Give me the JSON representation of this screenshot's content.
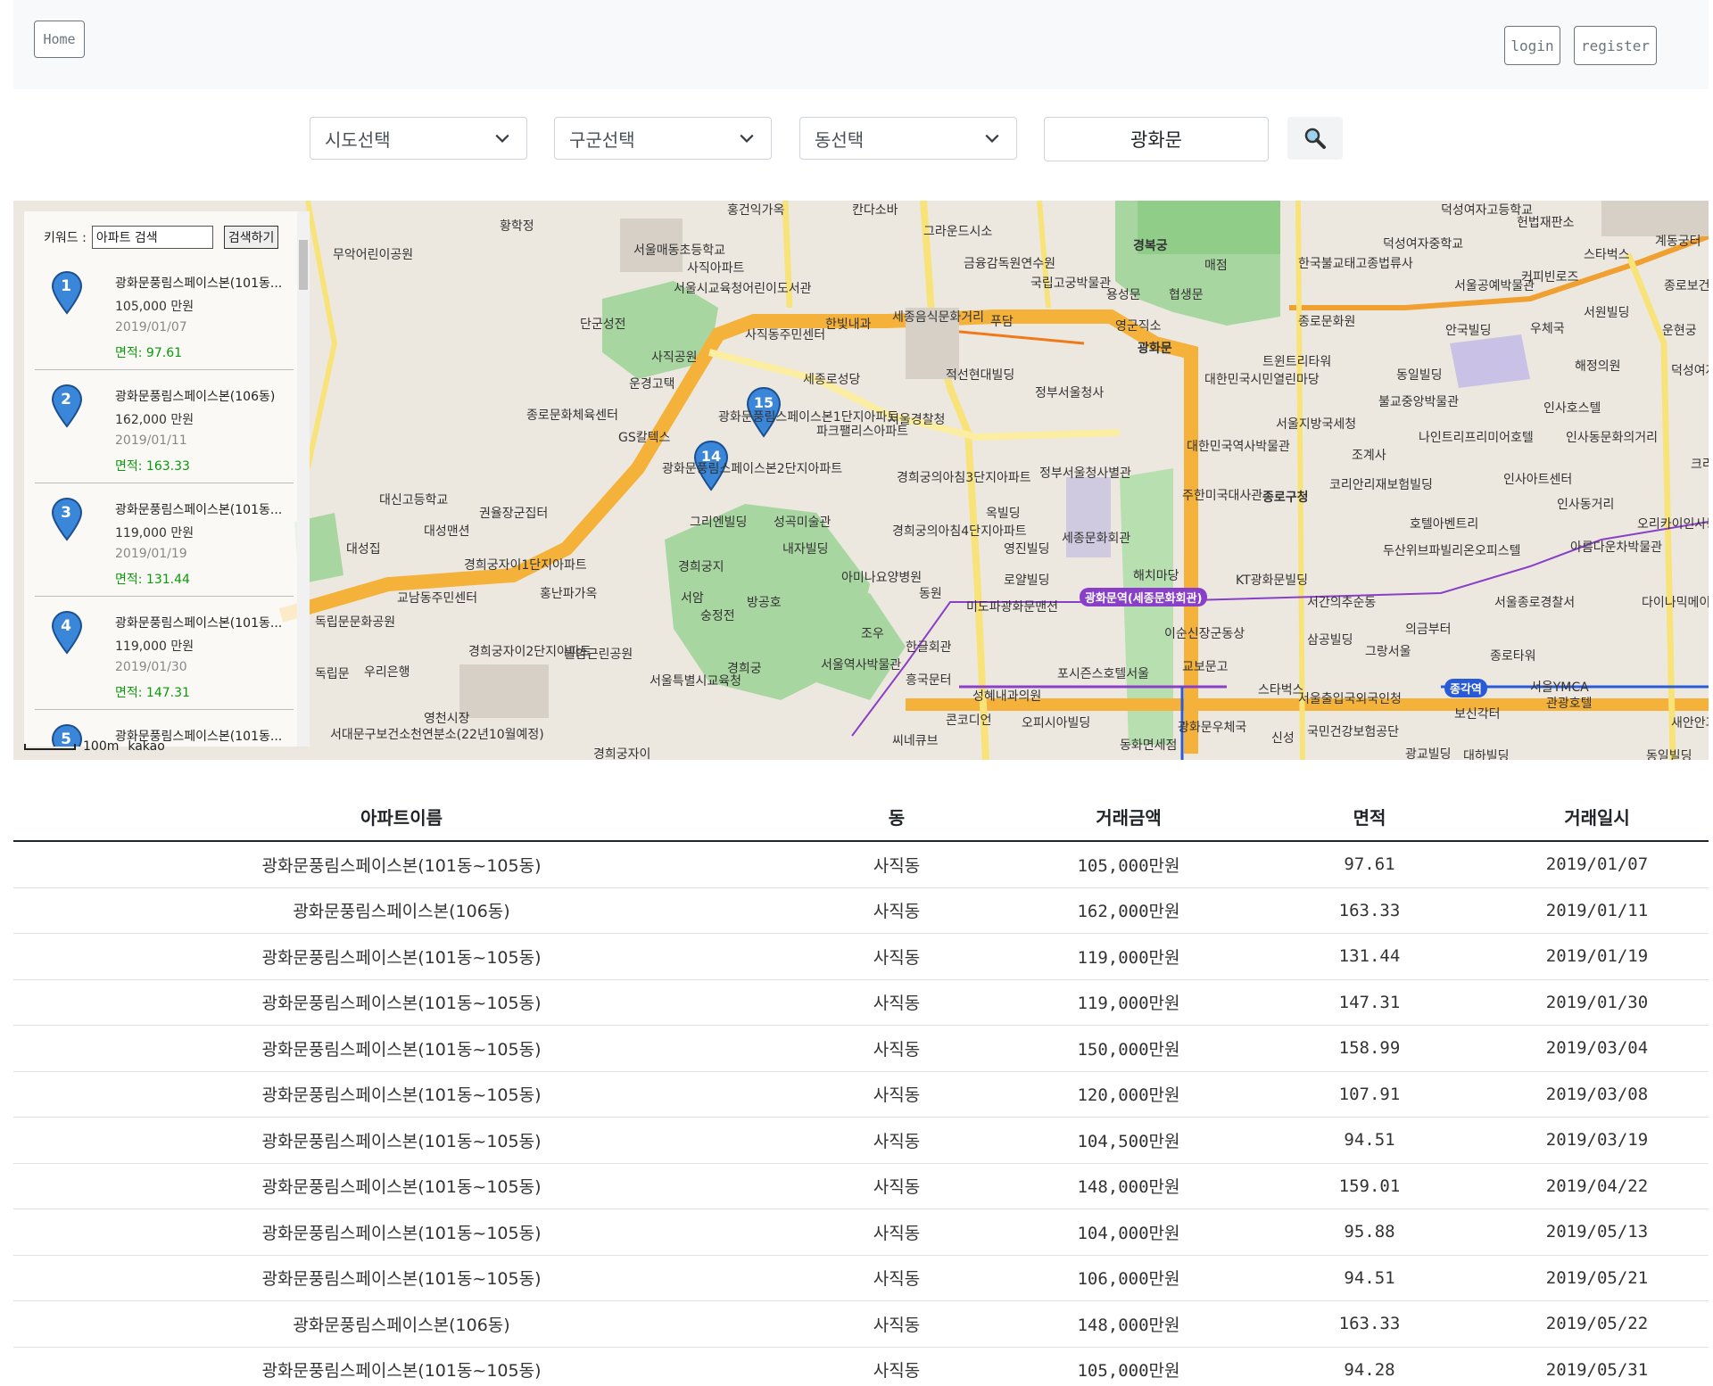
{
  "header": {
    "home_label": "Home",
    "login_label": "login",
    "register_label": "register"
  },
  "search": {
    "sido_label": "시도선택",
    "gugun_label": "구군선택",
    "dong_label": "동선택",
    "keyword_value": "광화문",
    "search_icon": "search-icon"
  },
  "map": {
    "panel": {
      "keyword_label": "키워드 :",
      "keyword_value": "아파트 검색",
      "search_button": "검색하기",
      "results": [
        {
          "num": "1",
          "name": "광화문풍림스페이스본(101동...",
          "price": "105,000 만원",
          "date": "2019/01/07",
          "area": "면적: 97.61"
        },
        {
          "num": "2",
          "name": "광화문풍림스페이스본(106동)",
          "price": "162,000 만원",
          "date": "2019/01/11",
          "area": "면적: 163.33"
        },
        {
          "num": "3",
          "name": "광화문풍림스페이스본(101동...",
          "price": "119,000 만원",
          "date": "2019/01/19",
          "area": "면적: 131.44"
        },
        {
          "num": "4",
          "name": "광화문풍림스페이스본(101동...",
          "price": "119,000 만원",
          "date": "2019/01/30",
          "area": "면적: 147.31"
        },
        {
          "num": "5",
          "name": "광화문풍림스페이스본(101동...",
          "price": "",
          "date": "",
          "area": ""
        }
      ]
    },
    "scale_label": "100m",
    "brand": "kakao",
    "markers": [
      "15",
      "14"
    ],
    "labels": [
      "홍건익가옥",
      "칸다소바",
      "그라운드시소",
      "황학정",
      "서울매동초등학교",
      "무악어린이공원",
      "사직아파트",
      "서울시교육청어린이도서관",
      "금융감독원연수원",
      "국립고궁박물관",
      "용성문",
      "협생문",
      "경복궁",
      "매점",
      "덕성여자중학교",
      "한국불교태고종법류사",
      "덕성여자고등학교",
      "헌법재판소",
      "서울공예박물관",
      "커피빈로즈",
      "스타벅스",
      "계동궁터",
      "종로보건소",
      "단군성전",
      "사직동주민센터",
      "한빛내과",
      "세종음식문화거리",
      "푸담",
      "영군직소",
      "종로문화원",
      "안국빌딩",
      "우체국",
      "서원빌딩",
      "운현궁",
      "사직공원",
      "세종로성당",
      "적선현대빌딩",
      "광화문",
      "트윈트리타워",
      "동일빌딩",
      "해정의원",
      "덕성여자대학교",
      "운경고택",
      "정부서울청사",
      "대한민국시민열린마당",
      "불교중앙박물관",
      "인사호스텔",
      "종로문화체육센터",
      "GS칼텍스",
      "광화문풍림스페이스본1단지아파트",
      "파크팰리스아파트",
      "서울경찰청",
      "서울지방국세청",
      "나인트리프리미어호텔",
      "조계사",
      "인사동문화의거리",
      "광화문풍림스페이스본2단지아파트",
      "경희궁의아침3단지아파트",
      "정부서울청사별관",
      "대한민국역사박물관",
      "코리안리재보험빌딩",
      "인사아트센터",
      "크리",
      "대신고등학교",
      "권율장군집터",
      "그리엔빌딩",
      "성곡미술관",
      "옥빌딩",
      "주한미국대사관",
      "종로구청",
      "인사동거리",
      "대성맨션",
      "호텔아벤트리",
      "오리카이인사동스위트",
      "대성집",
      "내자빌딩",
      "경희궁의아침4단지아파트",
      "영진빌딩",
      "세종문화회관",
      "두산위브파빌리온오피스텔",
      "아름다운차박물관",
      "경희궁자이1단지아파트",
      "경희궁지",
      "아미나요양병원",
      "로얄빌딩",
      "해치마당",
      "KT광화문빌딩",
      "교남동주민센터",
      "홍난파가옥",
      "서암",
      "숭정전",
      "방공호",
      "동원",
      "미도파광화문맨션",
      "광화문역(세종문화회관)",
      "서간의추순동",
      "서울종로경찰서",
      "다이나믹메이즈",
      "독립문문화공원",
      "우리은행",
      "경희궁자이2단지아파트",
      "월암근린공원",
      "조우",
      "한글회관",
      "이순신장군동상",
      "교보문고",
      "삼공빌딩",
      "그랑서울",
      "의금부터",
      "서울특별시교육청",
      "경희궁",
      "서울역사박물관",
      "흥국문터",
      "포시즌스호텔서울",
      "스타벅스",
      "종로타워",
      "서울YMCA",
      "종각역",
      "관광호텔",
      "독립문",
      "영천시장",
      "성혜내과의원",
      "콘코디언",
      "오피시아빌딩",
      "서울출입국외국인청",
      "보신각터",
      "새안안과의원",
      "서대문구보건소천연분소(22년10월예정)",
      "씨네큐브",
      "동화면세점",
      "광화문우체국",
      "신성",
      "국민건강보험공단",
      "광교빌딩",
      "경희궁자이",
      "대하빌딩",
      "동일빌딩"
    ]
  },
  "table": {
    "headers": [
      "아파트이름",
      "동",
      "거래금액",
      "면적",
      "거래일시"
    ],
    "rows": [
      [
        "광화문풍림스페이스본(101동~105동)",
        "사직동",
        "105,000만원",
        "97.61",
        "2019/01/07"
      ],
      [
        "광화문풍림스페이스본(106동)",
        "사직동",
        "162,000만원",
        "163.33",
        "2019/01/11"
      ],
      [
        "광화문풍림스페이스본(101동~105동)",
        "사직동",
        "119,000만원",
        "131.44",
        "2019/01/19"
      ],
      [
        "광화문풍림스페이스본(101동~105동)",
        "사직동",
        "119,000만원",
        "147.31",
        "2019/01/30"
      ],
      [
        "광화문풍림스페이스본(101동~105동)",
        "사직동",
        "150,000만원",
        "158.99",
        "2019/03/04"
      ],
      [
        "광화문풍림스페이스본(101동~105동)",
        "사직동",
        "120,000만원",
        "107.91",
        "2019/03/08"
      ],
      [
        "광화문풍림스페이스본(101동~105동)",
        "사직동",
        "104,500만원",
        "94.51",
        "2019/03/19"
      ],
      [
        "광화문풍림스페이스본(101동~105동)",
        "사직동",
        "148,000만원",
        "159.01",
        "2019/04/22"
      ],
      [
        "광화문풍림스페이스본(101동~105동)",
        "사직동",
        "104,000만원",
        "95.88",
        "2019/05/13"
      ],
      [
        "광화문풍림스페이스본(101동~105동)",
        "사직동",
        "106,000만원",
        "94.51",
        "2019/05/21"
      ],
      [
        "광화문풍림스페이스본(106동)",
        "사직동",
        "148,000만원",
        "163.33",
        "2019/05/22"
      ],
      [
        "광화문풍림스페이스본(101동~105동)",
        "사직동",
        "105,000만원",
        "94.28",
        "2019/05/31"
      ]
    ]
  }
}
